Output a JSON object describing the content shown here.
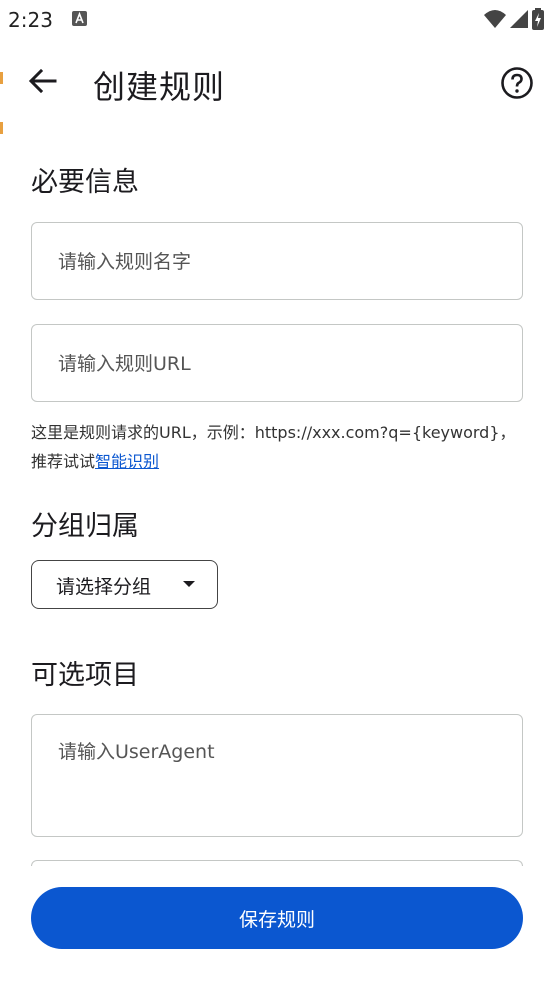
{
  "status_bar": {
    "time": "2:23",
    "notification_icon": "a-icon",
    "right_icons": [
      "wifi-icon",
      "signal-icon",
      "battery-charging-icon"
    ]
  },
  "app_bar": {
    "title": "创建规则",
    "back_icon": "arrow-back-icon",
    "help_icon": "help-circle-icon"
  },
  "required_section": {
    "title": "必要信息",
    "name_placeholder": "请输入规则名字",
    "url_placeholder": "请输入规则URL",
    "helper_prefix": "这里是规则请求的URL，示例：https://xxx.com?q={keyword}，推荐试试",
    "helper_link": "智能识别"
  },
  "group_section": {
    "title": "分组归属",
    "dropdown_label": "请选择分组"
  },
  "optional_section": {
    "title": "可选项目",
    "user_agent_placeholder": "请输入UserAgent"
  },
  "save_button": {
    "label": "保存规则"
  },
  "colors": {
    "accent": "#0b57d0",
    "outline": "#c4c7c5"
  }
}
